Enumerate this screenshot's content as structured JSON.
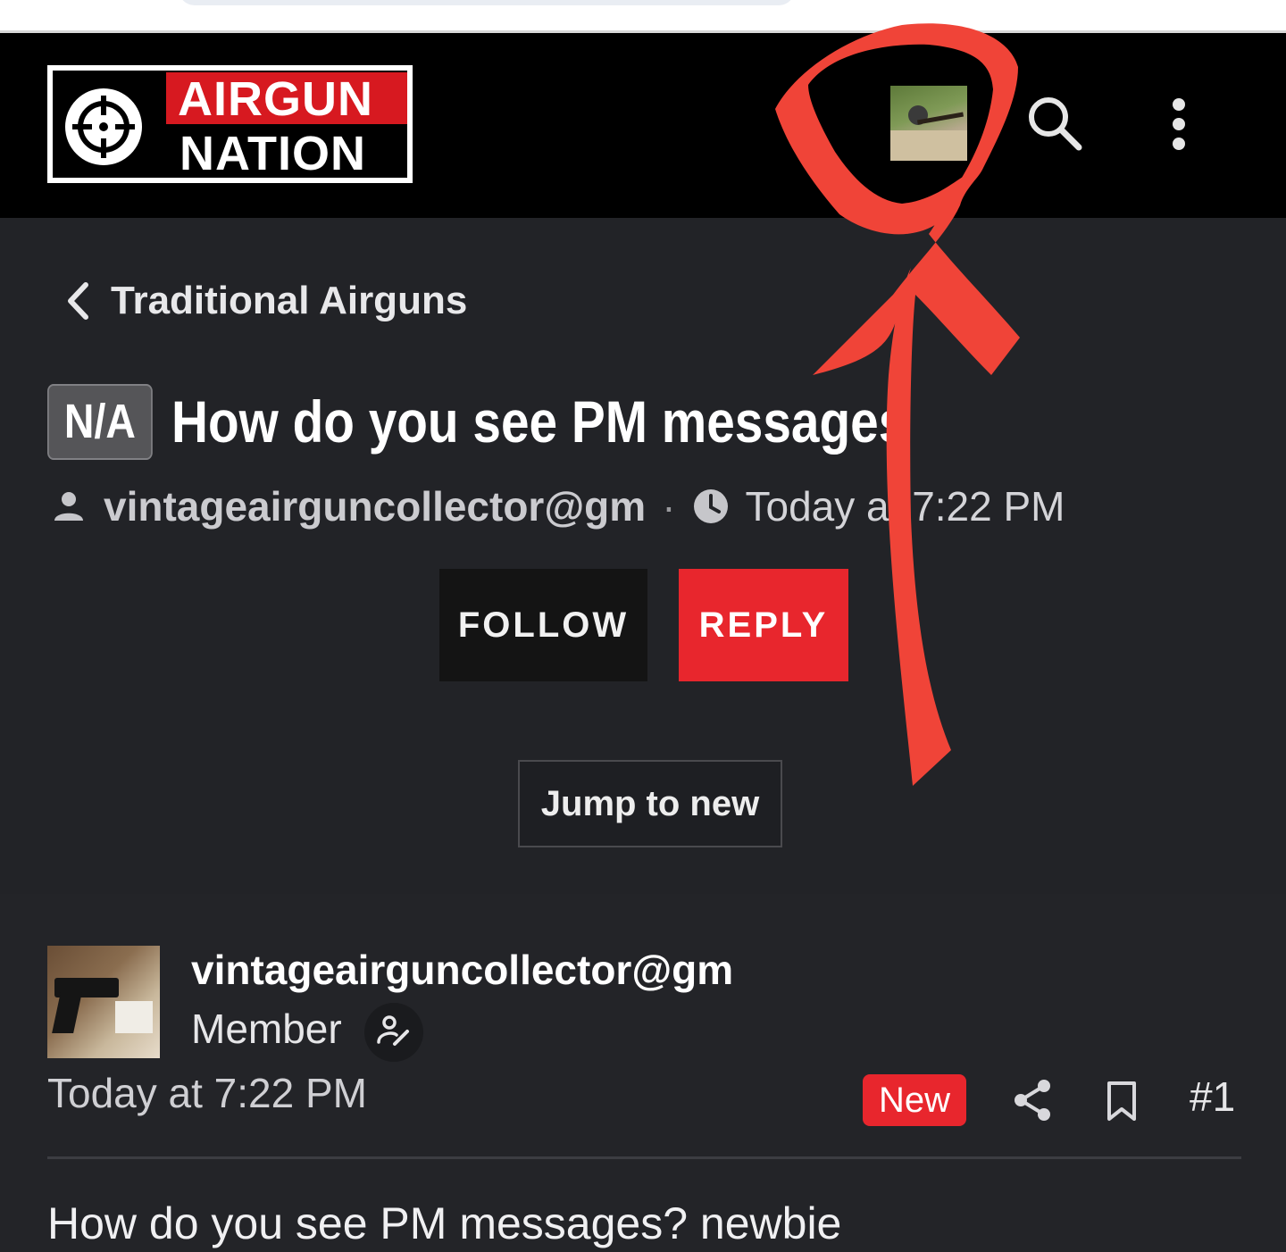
{
  "header": {
    "logo": {
      "line1": "AIRGUN",
      "line2": "NATION"
    },
    "search_icon": "search-icon",
    "menu_icon": "more-vertical-icon"
  },
  "thread": {
    "breadcrumb": "Traditional Airguns",
    "prefix": "N/A",
    "title": "How do you see PM messages",
    "author": "vintageairguncollector@gm",
    "meta_separator": "·",
    "date": "Today at 7:22 PM",
    "follow_label": "FOLLOW",
    "reply_label": "REPLY",
    "jump_label": "Jump to new"
  },
  "post": {
    "username": "vintageairguncollector@gm",
    "role": "Member",
    "date": "Today at 7:22 PM",
    "badge": "New",
    "number": "#1",
    "body": "How do you see PM messages? newbie"
  },
  "colors": {
    "accent_red": "#e8262d",
    "header_bg": "#000000",
    "page_bg": "#222327",
    "annotation_red": "#f04438"
  }
}
